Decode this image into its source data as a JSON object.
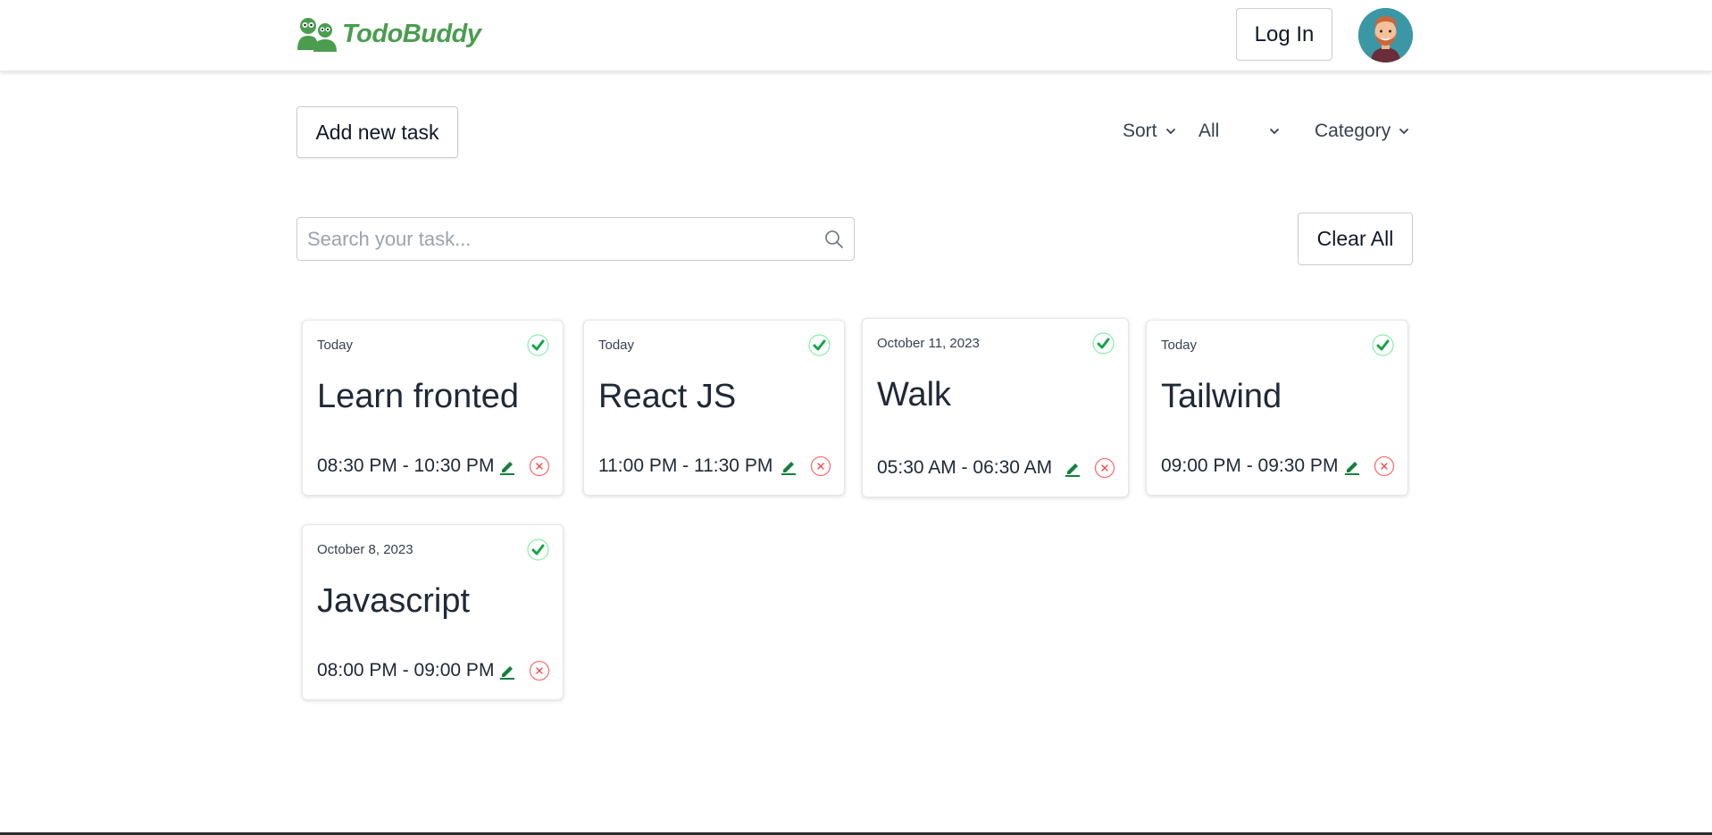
{
  "brand": {
    "name": "TodoBuddy",
    "color": "#4a9d4f"
  },
  "header": {
    "login_label": "Log In"
  },
  "toolbar": {
    "add_label": "Add new task",
    "sort_label": "Sort",
    "filter_value": "All",
    "category_label": "Category",
    "clear_label": "Clear All"
  },
  "search": {
    "placeholder": "Search your task...",
    "value": ""
  },
  "tasks": [
    {
      "date": "Today",
      "title": "Learn fronted",
      "time": "08:30 PM - 10:30 PM",
      "done": true
    },
    {
      "date": "Today",
      "title": "React JS",
      "time": "11:00 PM - 11:30 PM",
      "done": true
    },
    {
      "date": "October 11, 2023",
      "title": "Walk",
      "time": "05:30 AM - 06:30 AM",
      "done": true
    },
    {
      "date": "Today",
      "title": "Tailwind",
      "time": "09:00 PM - 09:30 PM",
      "done": true
    },
    {
      "date": "October 8, 2023",
      "title": "Javascript",
      "time": "08:00 PM - 09:00 PM",
      "done": true
    }
  ],
  "colors": {
    "check": "#16a34a",
    "edit": "#15803d",
    "delete": "#ef4444"
  }
}
